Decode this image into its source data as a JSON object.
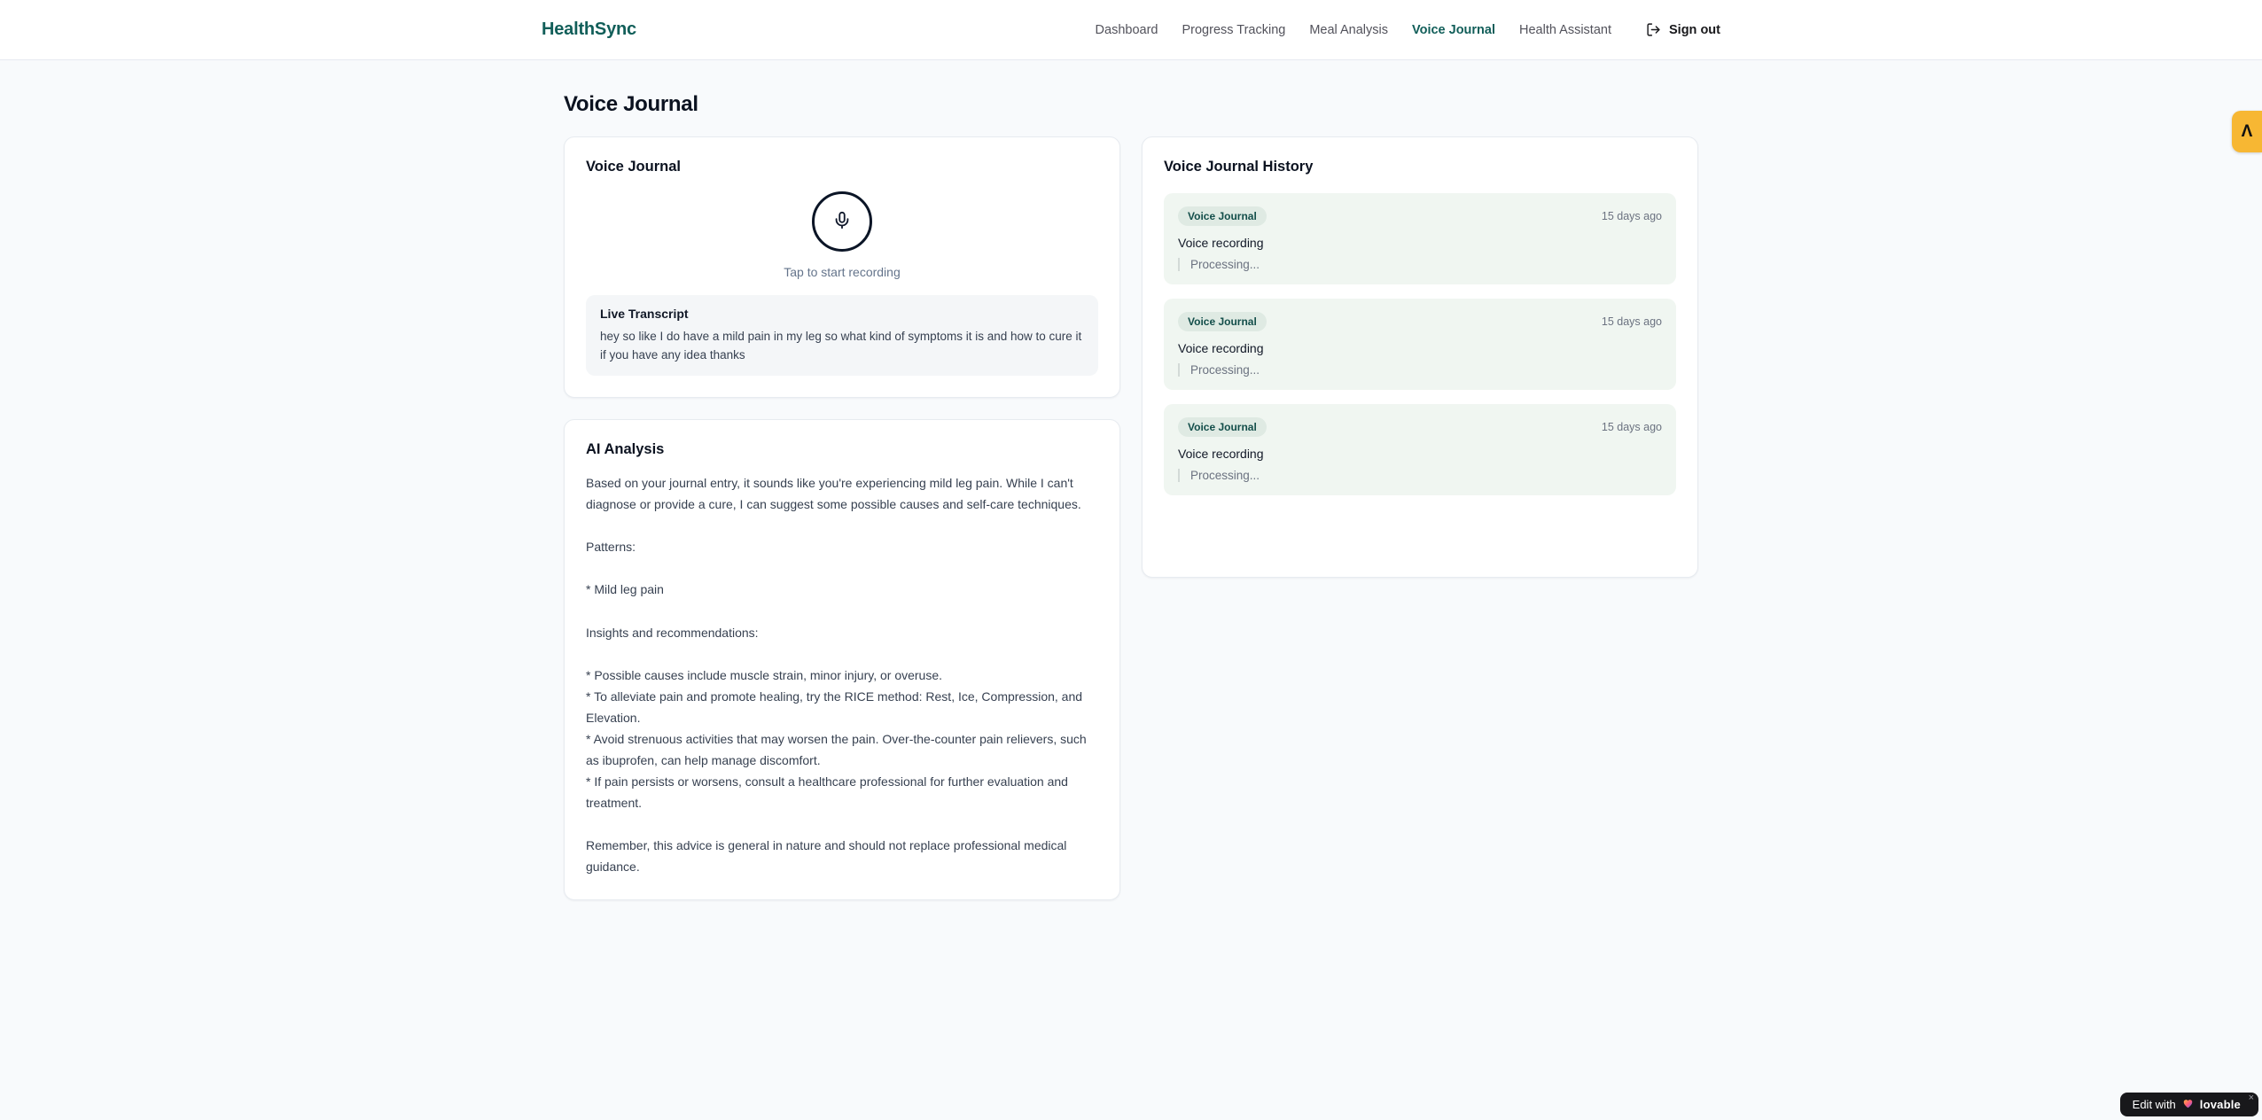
{
  "brand": {
    "name": "HealthSync"
  },
  "nav": {
    "items": [
      {
        "label": "Dashboard"
      },
      {
        "label": "Progress Tracking"
      },
      {
        "label": "Meal Analysis"
      },
      {
        "label": "Voice Journal",
        "active": true
      },
      {
        "label": "Health Assistant"
      }
    ],
    "sign_out_label": "Sign out"
  },
  "page": {
    "title": "Voice Journal"
  },
  "recorder": {
    "title": "Voice Journal",
    "hint": "Tap to start recording",
    "transcript": {
      "title": "Live Transcript",
      "text": "hey so like I do have a mild pain in my leg so what kind of symptoms it is and how to cure it if you have any idea thanks"
    }
  },
  "analysis": {
    "title": "AI Analysis",
    "body": "Based on your journal entry, it sounds like you're experiencing mild leg pain. While I can't diagnose or provide a cure, I can suggest some possible causes and self-care techniques.\n\nPatterns:\n\n* Mild leg pain\n\nInsights and recommendations:\n\n* Possible causes include muscle strain, minor injury, or overuse.\n* To alleviate pain and promote healing, try the RICE method: Rest, Ice, Compression, and Elevation.\n* Avoid strenuous activities that may worsen the pain. Over-the-counter pain relievers, such as ibuprofen, can help manage discomfort.\n* If pain persists or worsens, consult a healthcare professional for further evaluation and treatment.\n\nRemember, this advice is general in nature and should not replace professional medical guidance."
  },
  "history": {
    "title": "Voice Journal History",
    "entries": [
      {
        "badge": "Voice Journal",
        "time": "15 days ago",
        "label": "Voice recording",
        "status": "Processing..."
      },
      {
        "badge": "Voice Journal",
        "time": "15 days ago",
        "label": "Voice recording",
        "status": "Processing..."
      },
      {
        "badge": "Voice Journal",
        "time": "15 days ago",
        "label": "Voice recording",
        "status": "Processing..."
      }
    ]
  },
  "overlays": {
    "side_tab_glyph": "Λ",
    "edit_badge": {
      "prefix": "Edit with",
      "brand": "lovable",
      "close": "×"
    }
  },
  "colors": {
    "accent_teal": "#115e59",
    "page_bg": "#f8fafc",
    "history_entry_bg": "#f0f6f1",
    "badge_bg": "#dfeae3",
    "badge_text": "#134e4a",
    "mic_border": "#0b1526",
    "side_tab_bg": "#f7b733",
    "edit_badge_bg": "#18181b"
  }
}
